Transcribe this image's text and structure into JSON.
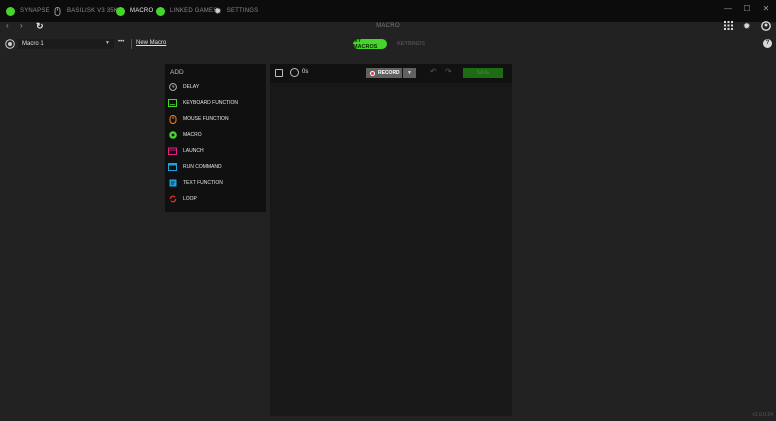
{
  "tabs": [
    {
      "label": "SYNAPSE",
      "icon": "razer-logo-icon"
    },
    {
      "label": "BASILISK V3 35K",
      "icon": "mouse-icon"
    },
    {
      "label": "MACRO",
      "icon": "macro-icon"
    },
    {
      "label": "LINKED GAMES",
      "icon": "gamepad-icon"
    },
    {
      "label": "SETTINGS",
      "icon": "gear-icon"
    }
  ],
  "window_controls": {
    "minimize": "—",
    "maximize": "☐",
    "close": "✕"
  },
  "nav": {
    "back": "‹",
    "forward": "›",
    "refresh": "↻"
  },
  "page_title": "MACRO",
  "toolbar": {
    "macro_select_value": "Macro 1",
    "more_label": "•••",
    "new_macro_label": "New Macro",
    "segment_my_macros": "MY MACROS",
    "segment_keybinds": "KEYBINDS",
    "help": "?"
  },
  "add_panel": {
    "title": "ADD",
    "items": [
      {
        "label": "DELAY",
        "icon": "clock-icon",
        "color": "#bdbdbd"
      },
      {
        "label": "KEYBOARD FUNCTION",
        "icon": "keyboard-icon",
        "color": "#44d62c"
      },
      {
        "label": "MOUSE FUNCTION",
        "icon": "mouse-icon",
        "color": "#ff7a1a"
      },
      {
        "label": "MACRO",
        "icon": "macro-icon",
        "color": "#44d62c"
      },
      {
        "label": "LAUNCH",
        "icon": "launch-icon",
        "color": "#e0218a"
      },
      {
        "label": "RUN COMMAND",
        "icon": "terminal-icon",
        "color": "#1fa3e0"
      },
      {
        "label": "TEXT FUNCTION",
        "icon": "text-icon",
        "color": "#1fa3e0"
      },
      {
        "label": "LOOP",
        "icon": "loop-icon",
        "color": "#e0302c"
      }
    ]
  },
  "editor": {
    "time": "0s",
    "record_label": "RECORD",
    "save_label": "SAVE"
  },
  "version": "v1.0.0.24"
}
